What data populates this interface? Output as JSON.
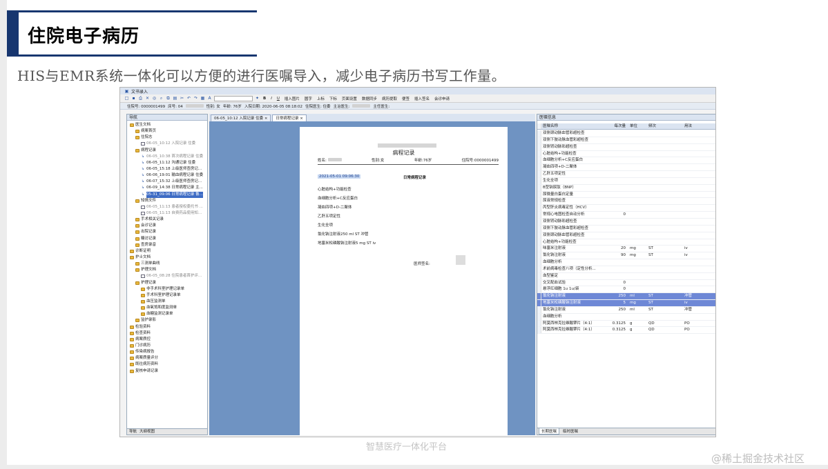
{
  "slide": {
    "title": "住院电子病历",
    "subtitle": "HIS与EMR系统一体化可以方便的进行医嘱导入，减少电子病历书写工作量。",
    "footer": "智慧医疗一体化平台",
    "watermark": "@稀土掘金技术社区"
  },
  "app": {
    "window_title": "文书录入",
    "toolbar_labels": [
      "B",
      "I",
      "U",
      "插入图片",
      "圆字",
      "上标",
      "下标",
      "页面设置",
      "数据同步",
      "病历提取",
      "便签",
      "插入签名",
      "会诊申请"
    ],
    "infobar": [
      "住院号: 0000001499",
      "床号: 04",
      "性别: 女",
      "年龄: 76岁",
      "入院日期: 2020-06-05 08:18:02",
      "住院医生: 住委",
      "主治医生:",
      "主任医生:"
    ]
  },
  "left_panel": {
    "header": "导航",
    "tree": [
      {
        "label": "医生文档",
        "icon": "folder",
        "level": 0
      },
      {
        "label": "病案首页",
        "icon": "folder",
        "level": 1
      },
      {
        "label": "住院志",
        "icon": "folder",
        "level": 1
      },
      {
        "label": "06-05_10:12 入院记录 住委",
        "icon": "doc",
        "level": 2,
        "grey": true
      },
      {
        "label": "病程记录",
        "icon": "folder",
        "level": 1
      },
      {
        "label": "06-05_10:38 首次病程记录 住委",
        "icon": "link",
        "level": 2,
        "grey": true
      },
      {
        "label": "06-05_11:12 沟通记录 住委",
        "icon": "link",
        "level": 2
      },
      {
        "label": "06-05_15:18 上级医师查房记...",
        "icon": "link",
        "level": 2
      },
      {
        "label": "06-06_19:01 输血病程记录 住委",
        "icon": "link",
        "level": 2
      },
      {
        "label": "06-07_15:32 上级医师查房记...",
        "icon": "link",
        "level": 2
      },
      {
        "label": "06-09_14:38 日常病程记录 主...",
        "icon": "link",
        "level": 2
      },
      {
        "label": "05-31_09:06 日常病程记录 鲁...",
        "icon": "link",
        "level": 2,
        "selected": true
      },
      {
        "label": "知情文件",
        "icon": "folder",
        "level": 1
      },
      {
        "label": "06-05_11:13 患者授权委托书 ...",
        "icon": "doc",
        "level": 2,
        "grey": true
      },
      {
        "label": "06-05_11:13 自费药品使用知...",
        "icon": "doc",
        "level": 2,
        "grey": true
      },
      {
        "label": "手术相关记录",
        "icon": "folder",
        "level": 1
      },
      {
        "label": "会诊记录",
        "icon": "folder",
        "level": 1
      },
      {
        "label": "出院记录",
        "icon": "folder",
        "level": 1
      },
      {
        "label": "糖访记录",
        "icon": "folder",
        "level": 1
      },
      {
        "label": "查房录音",
        "icon": "folder",
        "level": 1
      },
      {
        "label": "诊断证明",
        "icon": "folder",
        "level": 0
      },
      {
        "label": "护士文档",
        "icon": "folder",
        "level": 0
      },
      {
        "label": "三测单曲线",
        "icon": "folder",
        "level": 1
      },
      {
        "label": "护理文档",
        "icon": "folder",
        "level": 1
      },
      {
        "label": "06-05_08:28 住院患者首护评...",
        "icon": "doc",
        "level": 2,
        "grey": true
      },
      {
        "label": "护理记录",
        "icon": "folder",
        "level": 1
      },
      {
        "label": "非手术科室护理记录单",
        "icon": "folder",
        "level": 2
      },
      {
        "label": "手术科室护理记录单",
        "icon": "folder",
        "level": 2
      },
      {
        "label": "血压监测单",
        "icon": "folder",
        "level": 2
      },
      {
        "label": "血氧饱和度监测单",
        "icon": "folder",
        "level": 2
      },
      {
        "label": "血糖监测记录单",
        "icon": "folder",
        "level": 2
      },
      {
        "label": "监护录影",
        "icon": "folder",
        "level": 1
      },
      {
        "label": "检验资料",
        "icon": "folder",
        "level": 0
      },
      {
        "label": "检查资料",
        "icon": "folder",
        "level": 0
      },
      {
        "label": "病案质控",
        "icon": "folder",
        "level": 0
      },
      {
        "label": "门诊病历",
        "icon": "folder",
        "level": 0
      },
      {
        "label": "传染病报告",
        "icon": "folder",
        "level": 0
      },
      {
        "label": "病案质量评分",
        "icon": "folder",
        "level": 0
      },
      {
        "label": "既往病历资料",
        "icon": "folder",
        "level": 0
      },
      {
        "label": "复核申请记录",
        "icon": "folder",
        "level": 0
      }
    ],
    "tabs": [
      "导航",
      "大纲视图"
    ]
  },
  "editor": {
    "tabs": [
      "06-05_10:12 入院记录 住委",
      "日常病程记录"
    ],
    "doc_title": "病程记录",
    "name_label": "姓名:",
    "sex": "性别:女",
    "age": "年龄:76岁",
    "inpatient_no": "住院号:0000001499",
    "record_date": "2021-05-01 09:06:30",
    "record_type": "日常病程记录",
    "lines": [
      "心脏结构+功能检查",
      "血细胞分析+C反应蛋白",
      "凝血四项+D-二聚体",
      "乙肝五项定性",
      "生化全项",
      "氯化钠注射液250 ml   ST  冲管",
      "地塞米松磷酸钠注射液5  mg ST   iv"
    ],
    "signature_label": "医师签名:"
  },
  "right_panel": {
    "header": "医嘱信息",
    "columns": [
      "医嘱名称",
      "每次量",
      "单位",
      "频次",
      "用法"
    ],
    "rows": [
      [
        "双侧颈动脉血管彩超检查",
        "",
        "",
        "",
        ""
      ],
      [
        "双侧下肢动脉血管彩超检查",
        "",
        "",
        "",
        ""
      ],
      [
        "双侧肾动脉彩超检查",
        "",
        "",
        "",
        ""
      ],
      [
        "心脏结构+功能检查",
        "",
        "",
        "",
        ""
      ],
      [
        "血细胞分析+C反应蛋白",
        "",
        "",
        "",
        ""
      ],
      [
        "凝血四项+D-二聚体",
        "",
        "",
        "",
        ""
      ],
      [
        "乙肝五项定性",
        "",
        "",
        "",
        ""
      ],
      [
        "生化全项",
        "",
        "",
        "",
        ""
      ],
      [
        "B型钠尿肽（BNP）",
        "",
        "",
        "",
        ""
      ],
      [
        "尿微量白蛋白定量",
        "",
        "",
        "",
        ""
      ],
      [
        "尿液常规检查",
        "",
        "",
        "",
        ""
      ],
      [
        "丙型肝炎病毒定性（HCV）",
        "",
        "",
        "",
        ""
      ],
      [
        "常规心电图检查自动分析",
        "0",
        "",
        "",
        ""
      ],
      [
        "双侧肾动脉彩超检查",
        "",
        "",
        "",
        ""
      ],
      [
        "双侧下肢动脉血管彩超检查",
        "",
        "",
        "",
        ""
      ],
      [
        "双侧颈动脉血管彩超检查",
        "",
        "",
        "",
        ""
      ],
      [
        "心脏结构+功能检查",
        "",
        "",
        "",
        ""
      ],
      [
        "味塞米注射液",
        "20",
        "mg",
        "ST",
        "iv"
      ],
      [
        "氯化钠注射液",
        "90",
        "mg",
        "ST",
        "iv"
      ],
      [
        "血细胞分析",
        "",
        "",
        "",
        ""
      ],
      [
        "术前病毒检查八项（定性分析...",
        "",
        "",
        "",
        ""
      ],
      [
        "血型鉴定",
        "",
        "",
        "",
        ""
      ],
      [
        "交叉配血试验",
        "0",
        "",
        "",
        ""
      ],
      [
        "悬浮红细胞 1u 1u/袋",
        "0",
        "",
        "",
        ""
      ],
      [
        "氯化钠注射液",
        "250",
        "ml",
        "ST",
        "冲管"
      ],
      [
        "地塞米松磷酸钠注射液",
        "5",
        "mg",
        "ST",
        "iv"
      ],
      [
        "氯化钠注射液",
        "250",
        "ml",
        "ST",
        "冲管"
      ],
      [
        "血细胞分析",
        "",
        "",
        "",
        ""
      ],
      [
        "阿莫西林克拉维酸钾片（4:1）",
        "0.3125",
        "g",
        "QD",
        "PO"
      ],
      [
        "阿莫西林克拉维酸钾片（4:1）",
        "0.3125",
        "g",
        "QD",
        "PO"
      ]
    ],
    "selected_rows": [
      24,
      25
    ],
    "tabs": [
      "长期医嘱",
      "临时医嘱"
    ]
  }
}
